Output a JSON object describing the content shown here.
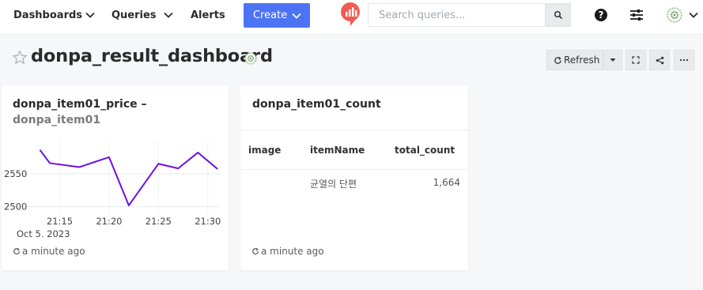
{
  "navbar": {
    "dashboards_label": "Dashboards",
    "queries_label": "Queries",
    "alerts_label": "Alerts",
    "create_label": "Create",
    "search_placeholder": "Search queries..."
  },
  "page": {
    "title": "donpa_result_dashboard",
    "refresh_label": "Refresh"
  },
  "widgets": {
    "chart": {
      "title": "donpa_item01_price –",
      "subtitle": "donpa_item01",
      "updated": "a minute ago"
    },
    "table": {
      "title": "donpa_item01_count",
      "columns": [
        "image",
        "itemName",
        "total_count"
      ],
      "rows": [
        {
          "image": "",
          "itemName": "균열의 단편",
          "total_count": "1,664"
        }
      ],
      "updated": "a minute ago"
    }
  },
  "colors": {
    "accent": "#4d73f5",
    "line": "#6a0fe8",
    "logo": "#f35b52"
  },
  "chart_data": {
    "type": "line",
    "x": [
      "21:13",
      "21:14",
      "21:17",
      "21:20",
      "21:22",
      "21:25",
      "21:27",
      "21:29",
      "21:31"
    ],
    "series": [
      {
        "values": [
          2586,
          2566,
          2560,
          2575,
          2502,
          2565,
          2558,
          2582,
          2557
        ]
      }
    ],
    "x_ticks": [
      "21:15",
      "21:20",
      "21:25",
      "21:30"
    ],
    "y_ticks": [
      "2550",
      "2500"
    ],
    "date_label": "Oct 5, 2023",
    "ylim": [
      2490,
      2600
    ],
    "grid": true
  }
}
